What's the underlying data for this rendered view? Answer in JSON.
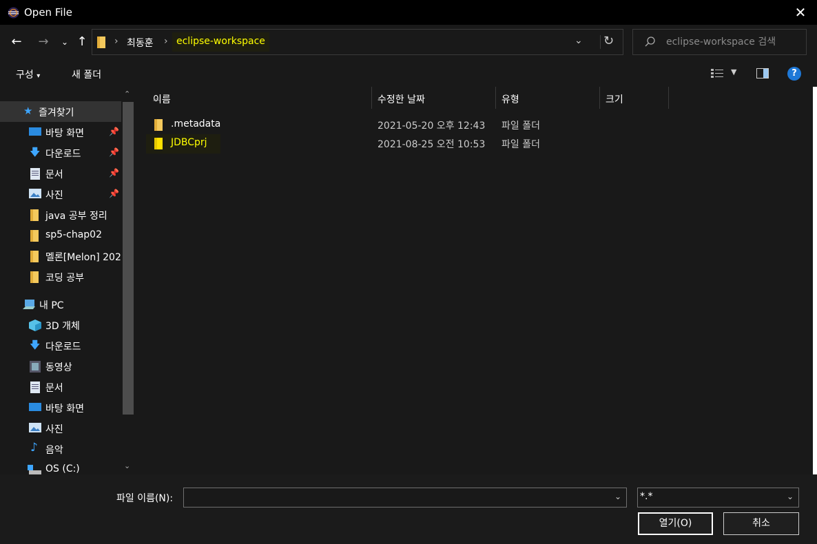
{
  "window": {
    "title": "Open File"
  },
  "address": {
    "crumbs": [
      "최동훈",
      "eclipse-workspace"
    ]
  },
  "search": {
    "placeholder": "eclipse-workspace 검색"
  },
  "toolbar": {
    "organize": "구성",
    "new_folder": "새 폴더",
    "help": "?"
  },
  "sidebar": {
    "items": [
      {
        "label": "즐겨찾기",
        "icon": "star-icon"
      },
      {
        "label": "바탕 화면",
        "icon": "desktop-icon",
        "pinned": true
      },
      {
        "label": "다운로드",
        "icon": "download-icon",
        "pinned": true
      },
      {
        "label": "문서",
        "icon": "document-icon",
        "pinned": true
      },
      {
        "label": "사진",
        "icon": "picture-icon",
        "pinned": true
      },
      {
        "label": "java 공부 정리",
        "icon": "folder-icon"
      },
      {
        "label": "sp5-chap02",
        "icon": "folder-icon"
      },
      {
        "label": "멜론[Melon] 202",
        "icon": "folder-icon"
      },
      {
        "label": "코딩 공부",
        "icon": "folder-icon"
      },
      {
        "label": "내 PC",
        "icon": "pc-icon"
      },
      {
        "label": "3D 개체",
        "icon": "cube-icon"
      },
      {
        "label": "다운로드",
        "icon": "download-icon"
      },
      {
        "label": "동영상",
        "icon": "video-icon"
      },
      {
        "label": "문서",
        "icon": "document-icon"
      },
      {
        "label": "바탕 화면",
        "icon": "desktop-icon"
      },
      {
        "label": "사진",
        "icon": "picture-icon"
      },
      {
        "label": "음악",
        "icon": "music-icon"
      },
      {
        "label": "OS (C:)",
        "icon": "drive-icon"
      }
    ]
  },
  "columns": [
    "이름",
    "수정한 날짜",
    "유형",
    "크기"
  ],
  "files": [
    {
      "name": ".metadata",
      "date": "2021-05-20 오후 12:43",
      "type": "파일 폴더",
      "size": ""
    },
    {
      "name": "JDBCprj",
      "date": "2021-08-25 오전 10:53",
      "type": "파일 폴더",
      "size": ""
    }
  ],
  "bottom": {
    "filename_label": "파일 이름(N):",
    "filename_value": "",
    "filter_value": "*.*",
    "open_label": "열기(O)",
    "cancel_label": "취소"
  },
  "colors": {
    "highlight_text": "#ffff00",
    "accent": "#1e78d7",
    "folder": "#f4c95d"
  }
}
